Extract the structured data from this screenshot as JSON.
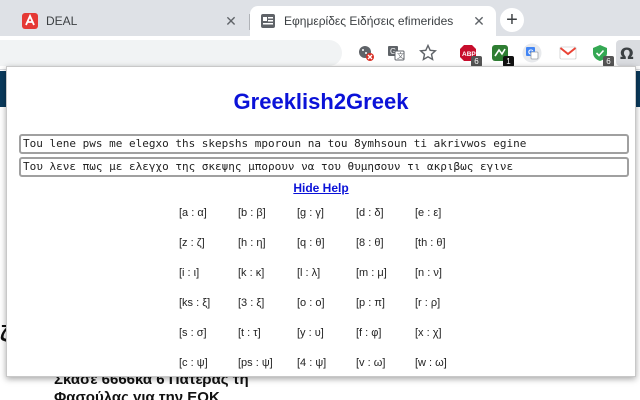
{
  "tabs": [
    {
      "title": "DEAL",
      "active": false,
      "favicon": "red-deal-logo-icon"
    },
    {
      "title": "Εφημερίδες Ειδήσεις efimerides",
      "active": true,
      "favicon": "news-site-icon"
    }
  ],
  "extensions": {
    "abp_badge": "6",
    "green_badge": "1",
    "shield_badge": "6"
  },
  "background": {
    "headline_line1": "Σκάσε 6666κα 6 Πατέρας τη",
    "headline_line2": "Φασούλας για την ΕΟΚ",
    "left_edge": "ζ"
  },
  "popup": {
    "title": "Greeklish2Greek",
    "latin_text": "Tou lene pws me elegxo ths skepshs mporoun na tou 8ymhsoun ti akrivwos egine",
    "greek_text": "Του λενε πως με ελεγχο της σκεψης μπορουν να του θυμησουν τι ακριβως εγινε",
    "hide_help": "Hide Help",
    "mappings": [
      [
        "[a : α]",
        "[b : β]",
        "[g : γ]",
        "[d : δ]",
        "[e : ε]"
      ],
      [
        "[z : ζ]",
        "[h : η]",
        "[q : θ]",
        "[8 : θ]",
        "[th : θ]"
      ],
      [
        "[i : ι]",
        "[k : κ]",
        "[l : λ]",
        "[m : μ]",
        "[n : ν]"
      ],
      [
        "[ks : ξ]",
        "[3 : ξ]",
        "[o : ο]",
        "[p : π]",
        "[r : ρ]"
      ],
      [
        "[s : σ]",
        "[t : τ]",
        "[y : υ]",
        "[f : φ]",
        "[x : χ]"
      ],
      [
        "[c : ψ]",
        "[ps : ψ]",
        "[4 : ψ]",
        "[v : ω]",
        "[w : ω]"
      ]
    ]
  },
  "colors": {
    "accent": "#0b12d8",
    "tabstrip": "#dee1e6",
    "navbar": "#0a3a5c"
  }
}
